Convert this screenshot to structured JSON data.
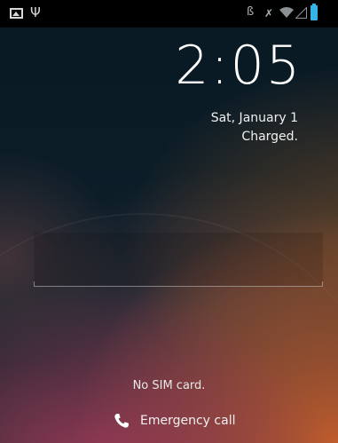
{
  "status_bar": {
    "left_icons": [
      "gallery-icon",
      "usb-icon"
    ],
    "right_icons": [
      "bluetooth-icon",
      "mute-icon",
      "wifi-icon",
      "signal-icon",
      "battery-icon"
    ],
    "usb_glyph": "Ψ",
    "bluetooth_glyph": "ß",
    "mute_glyph": "✗",
    "battery_color": "#33b5e5"
  },
  "lockscreen": {
    "time": "2:05",
    "date": "Sat, January 1",
    "status": "Charged.",
    "carrier": "No SIM card.",
    "emergency_label": "Emergency call"
  },
  "colors": {
    "accent": "#33b5e5",
    "text": "#ffffff"
  }
}
